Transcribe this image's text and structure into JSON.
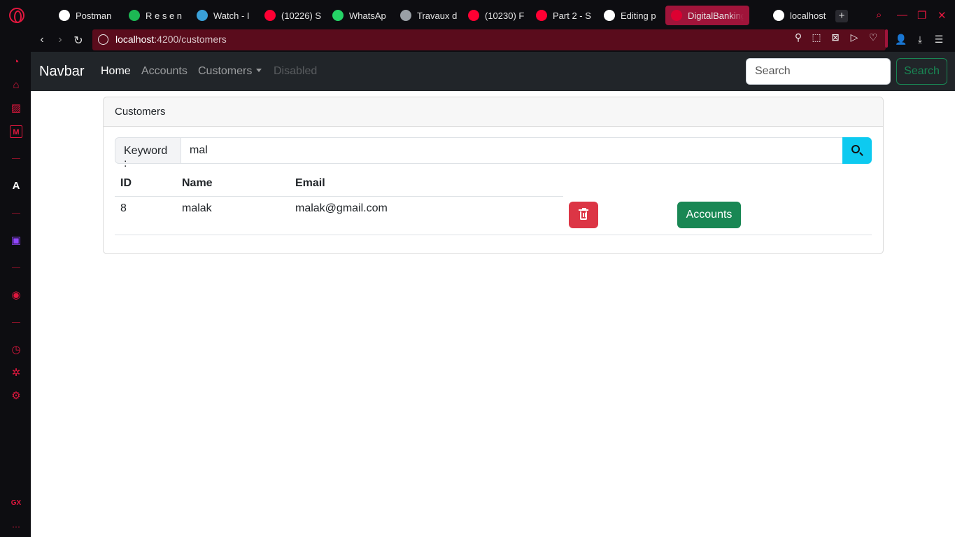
{
  "browser": {
    "tabs": [
      {
        "label": "Postman",
        "icon": "postman-icon",
        "color": "#ffffff"
      },
      {
        "label": "R e s e n",
        "icon": "spotify-icon",
        "color": "#1db954"
      },
      {
        "label": "Watch - I",
        "icon": "disney-icon",
        "color": "#3aa0d8"
      },
      {
        "label": "(10226) S",
        "icon": "youtube-icon",
        "color": "#ff0033"
      },
      {
        "label": "WhatsAp",
        "icon": "whatsapp-icon",
        "color": "#25d366"
      },
      {
        "label": "Travaux d",
        "icon": "classroom-icon",
        "color": "#9aa0a6"
      },
      {
        "label": "(10230) F",
        "icon": "youtube-icon",
        "color": "#ff0033"
      },
      {
        "label": "Part 2 - S",
        "icon": "youtube-icon",
        "color": "#ff0033"
      },
      {
        "label": "Editing p",
        "icon": "github-icon",
        "color": "#ffffff"
      },
      {
        "label": "DigitalBankingWe",
        "icon": "angular-icon",
        "color": "#dd0031",
        "active": true
      },
      {
        "label": "localhost",
        "icon": "globe-icon",
        "color": "#ffffff"
      }
    ],
    "address": {
      "host": "localhost",
      "path": ":4200/customers"
    },
    "accent": "#e0173e"
  },
  "app": {
    "brand": "Navbar",
    "nav": {
      "home": "Home",
      "accounts": "Accounts",
      "customers": "Customers",
      "disabled": "Disabled"
    },
    "search": {
      "placeholder": "Search",
      "button": "Search"
    }
  },
  "card": {
    "header": "Customers",
    "keyword_label": "Keyword :",
    "keyword_value": "mal",
    "columns": {
      "id": "ID",
      "name": "Name",
      "email": "Email"
    },
    "rows": [
      {
        "id": "8",
        "name": "malak",
        "email": "malak@gmail.com",
        "accounts_label": "Accounts"
      }
    ]
  },
  "sidebar": {
    "gx_label": "GX",
    "more_label": "···"
  }
}
